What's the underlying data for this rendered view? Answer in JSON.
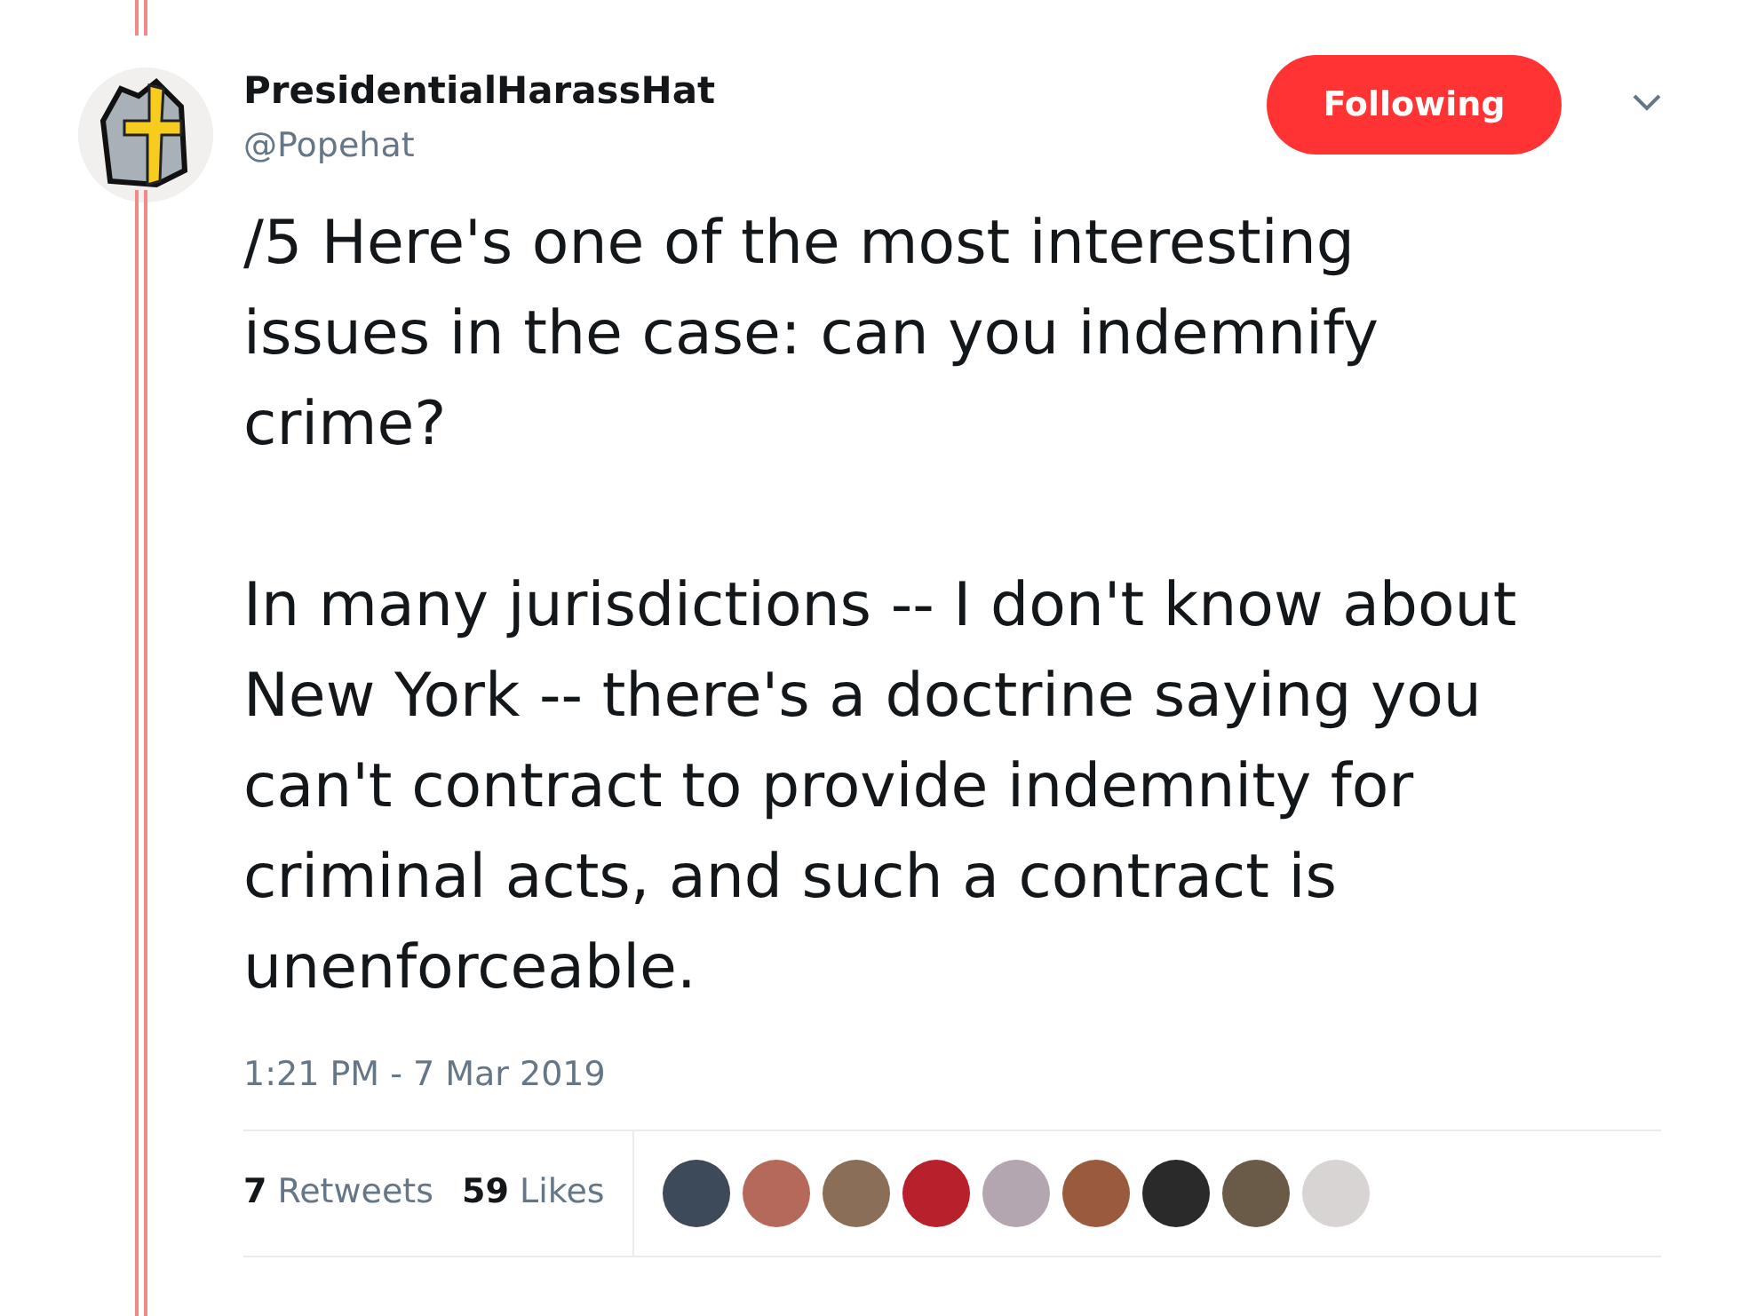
{
  "author": {
    "name": "PresidentialHarassHat",
    "handle": "@Popehat"
  },
  "follow_button": {
    "label": "Following",
    "selected": true
  },
  "tweet": {
    "paragraphs": [
      "/5 Here's one of the most interesting issues in the case:  can you indemnify crime?",
      "In many jurisdictions -- I don't know about New York -- there's a doctrine saying you can't contract to provide indemnity for criminal acts, and such a contract is unenforceable."
    ],
    "timestamp": "1:21 PM - 7 Mar 2019"
  },
  "stats": [
    {
      "count": "7",
      "label": "Retweets"
    },
    {
      "count": "59",
      "label": "Likes"
    }
  ],
  "likers": [
    {
      "color": "#3d4a5a"
    },
    {
      "color": "#b5695a"
    },
    {
      "color": "#8a6e58"
    },
    {
      "color": "#b8202c"
    },
    {
      "color": "#b4a6b0"
    },
    {
      "color": "#9a5a3e"
    },
    {
      "color": "#2a2a2a"
    },
    {
      "color": "#6a5a48"
    },
    {
      "color": "#d8d4d4"
    }
  ]
}
